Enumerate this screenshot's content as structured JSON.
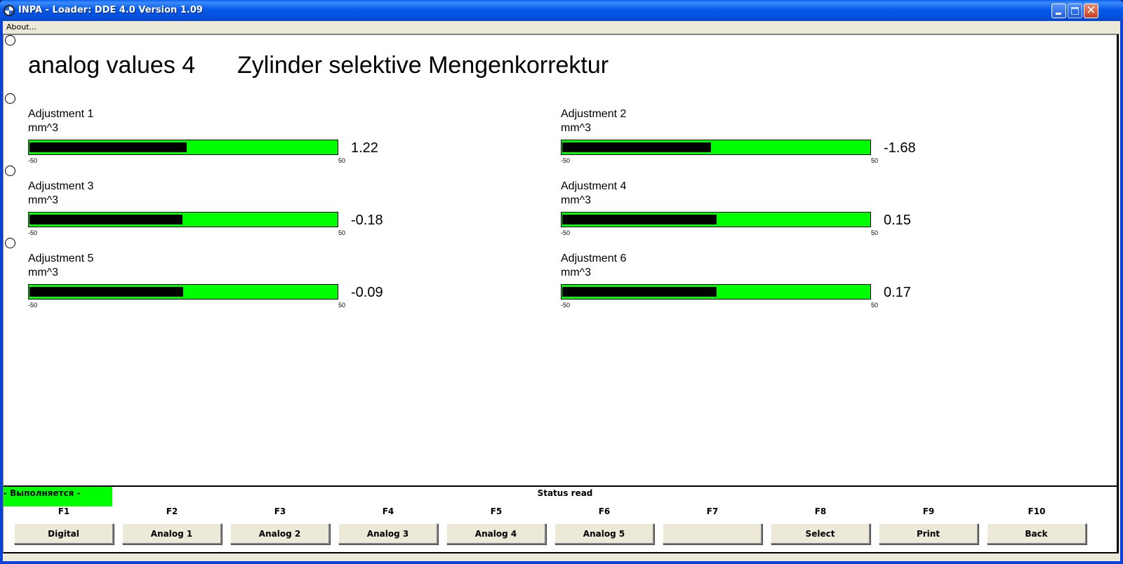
{
  "window": {
    "title": "INPA - Loader:  DDE 4.0 Version 1.09",
    "icon": "bmw-logo-icon",
    "controls": {
      "minimize": "minimize-icon",
      "maximize": "maximize-icon",
      "close": "close-icon",
      "close_glyph": "✕"
    }
  },
  "menu": {
    "items": [
      {
        "label": "About..."
      }
    ]
  },
  "header": {
    "screen_title": "analog values 4",
    "subtitle": "Zylinder selektive Mengenkorrektur"
  },
  "colors": {
    "bar_background": "#00ff00",
    "bar_fill": "#000000",
    "status_badge": "#00ff00",
    "title_bar": "#0658e8"
  },
  "gauges": [
    {
      "label": "Adjustment 1",
      "unit": "mm^3",
      "value": 1.22,
      "value_text": "1.22",
      "min": -50,
      "max": 50,
      "min_text": "-50",
      "max_text": "50"
    },
    {
      "label": "Adjustment 2",
      "unit": "mm^3",
      "value": -1.68,
      "value_text": "-1.68",
      "min": -50,
      "max": 50,
      "min_text": "-50",
      "max_text": "50"
    },
    {
      "label": "Adjustment 3",
      "unit": "mm^3",
      "value": -0.18,
      "value_text": "-0.18",
      "min": -50,
      "max": 50,
      "min_text": "-50",
      "max_text": "50"
    },
    {
      "label": "Adjustment 4",
      "unit": "mm^3",
      "value": 0.15,
      "value_text": "0.15",
      "min": -50,
      "max": 50,
      "min_text": "-50",
      "max_text": "50"
    },
    {
      "label": "Adjustment 5",
      "unit": "mm^3",
      "value": -0.09,
      "value_text": "-0.09",
      "min": -50,
      "max": 50,
      "min_text": "-50",
      "max_text": "50"
    },
    {
      "label": "Adjustment 6",
      "unit": "mm^3",
      "value": 0.17,
      "value_text": "0.17",
      "min": -50,
      "max": 50,
      "min_text": "-50",
      "max_text": "50"
    }
  ],
  "status": {
    "running_label": "- Выполняется -",
    "status_text": "Status read"
  },
  "function_keys": [
    {
      "key": "F1",
      "label": "Digital"
    },
    {
      "key": "F2",
      "label": "Analog 1"
    },
    {
      "key": "F3",
      "label": "Analog 2"
    },
    {
      "key": "F4",
      "label": "Analog 3"
    },
    {
      "key": "F5",
      "label": "Analog 4"
    },
    {
      "key": "F6",
      "label": "Analog 5"
    },
    {
      "key": "F7",
      "label": ""
    },
    {
      "key": "F8",
      "label": "Select"
    },
    {
      "key": "F9",
      "label": "Print"
    },
    {
      "key": "F10",
      "label": "Back"
    }
  ]
}
